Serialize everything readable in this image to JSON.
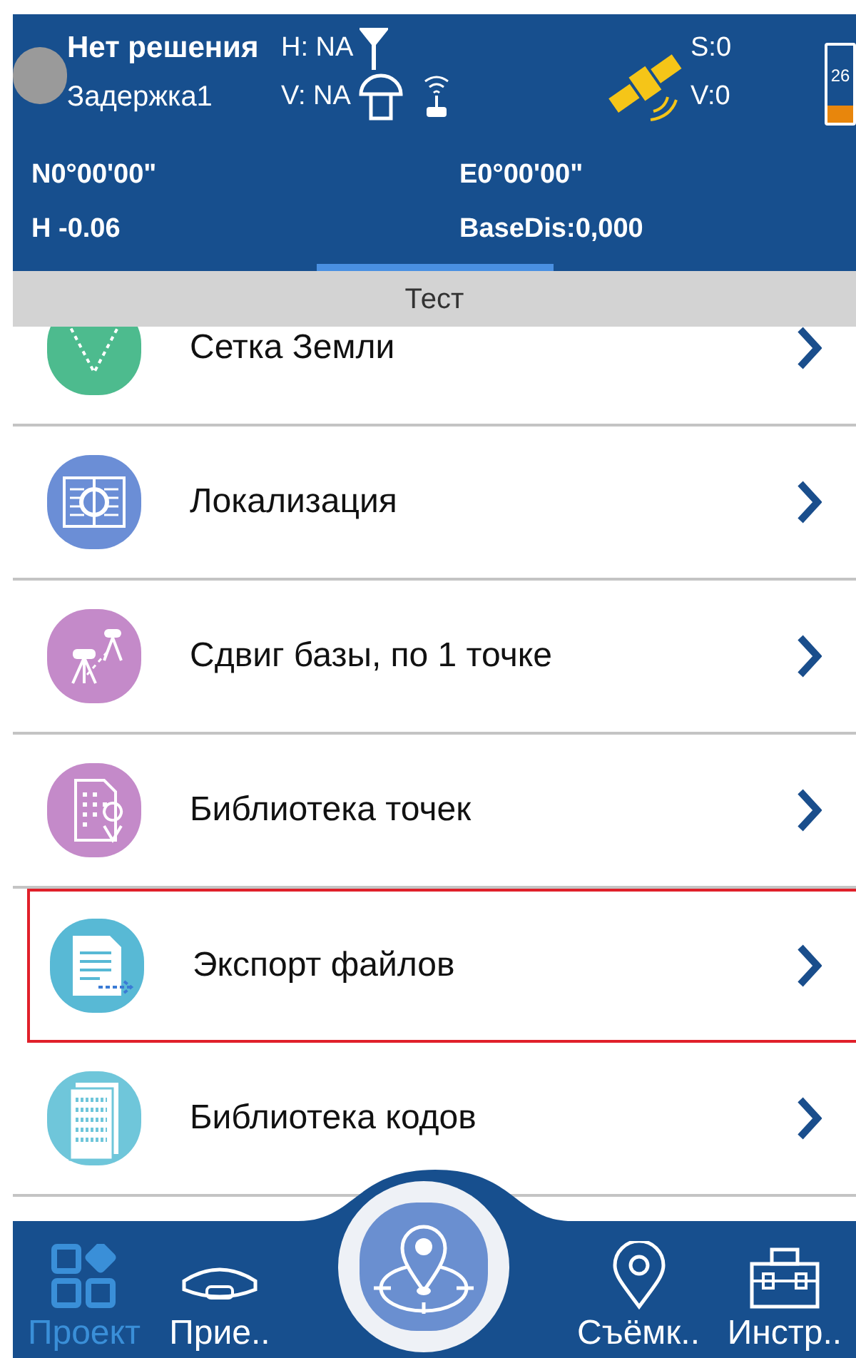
{
  "status": {
    "solution": "Нет решения",
    "delay": "Задержка1",
    "h": "H: NA",
    "v": "V: NA",
    "sats": "S:0",
    "sats_v": "V:0",
    "battery": "26"
  },
  "coords": {
    "n": "N0°00'00\"",
    "e": "E0°00'00\"",
    "h": "H -0.06",
    "base_dis": "BaseDis:0,000"
  },
  "tab": {
    "label": "Тест",
    "selected": true
  },
  "menu": [
    {
      "kind": "grid",
      "label": "Сетка Земли",
      "highlighted": false
    },
    {
      "kind": "localize",
      "label": "Локализация",
      "highlighted": false
    },
    {
      "kind": "shift",
      "label": "Сдвиг базы, по 1 точке",
      "highlighted": false
    },
    {
      "kind": "points",
      "label": "Библиотека точек",
      "highlighted": false
    },
    {
      "kind": "export",
      "label": "Экспорт файлов",
      "highlighted": true
    },
    {
      "kind": "codes",
      "label": "Библиотека кодов",
      "highlighted": false
    }
  ],
  "nav": [
    {
      "kind": "project",
      "label": "Проект",
      "selected": true
    },
    {
      "kind": "receiver",
      "label": "Прие..",
      "selected": false
    },
    {
      "kind": "center",
      "selected": false
    },
    {
      "kind": "survey",
      "label": "Съёмк..",
      "selected": false
    },
    {
      "kind": "tools",
      "label": "Инстр..",
      "selected": false
    }
  ]
}
